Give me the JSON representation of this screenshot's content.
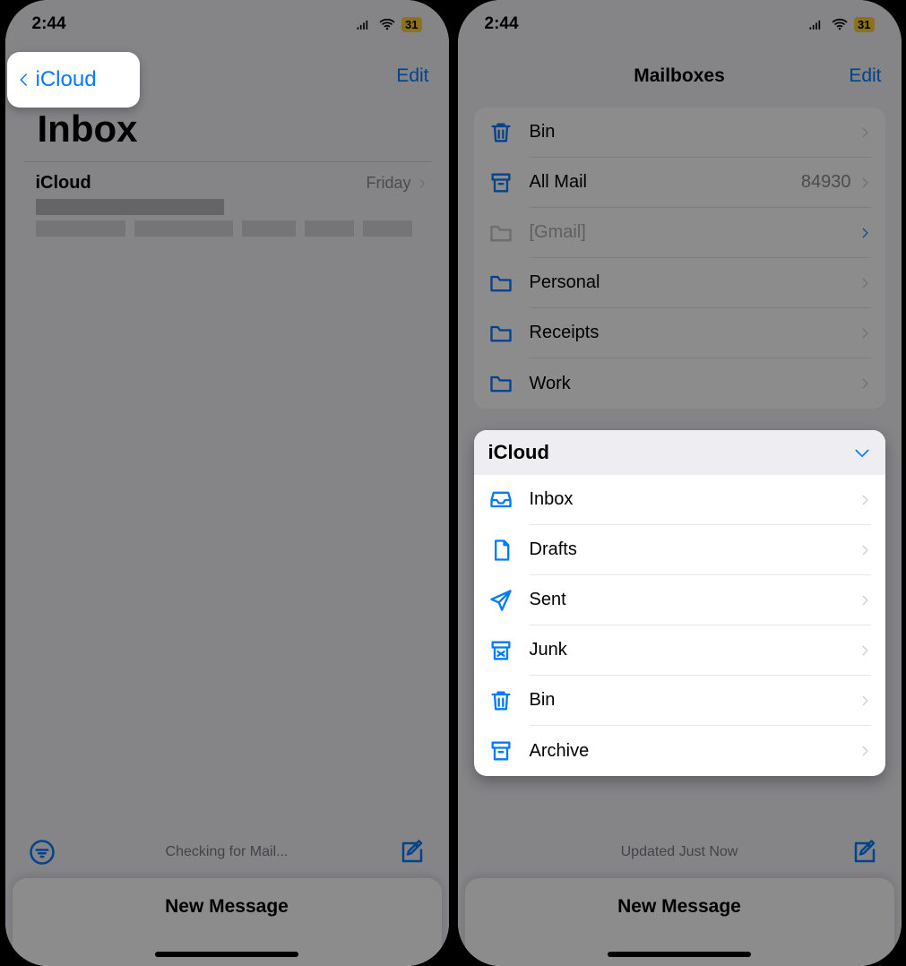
{
  "statusbar": {
    "time": "2:44",
    "battery": "31"
  },
  "left": {
    "nav": {
      "back": "iCloud",
      "edit": "Edit"
    },
    "title": "Inbox",
    "message": {
      "sender": "iCloud",
      "when": "Friday"
    },
    "toolbar_status": "Checking for Mail...",
    "sheet_title": "New Message"
  },
  "right": {
    "nav": {
      "title": "Mailboxes",
      "edit": "Edit"
    },
    "mailboxes": [
      {
        "icon": "trash",
        "label": "Bin",
        "count": ""
      },
      {
        "icon": "archive",
        "label": "All Mail",
        "count": "84930"
      },
      {
        "icon": "folder",
        "label": "[Gmail]",
        "count": "",
        "disabled": true
      },
      {
        "icon": "folder",
        "label": "Personal",
        "count": ""
      },
      {
        "icon": "folder",
        "label": "Receipts",
        "count": ""
      },
      {
        "icon": "folder",
        "label": "Work",
        "count": ""
      }
    ],
    "panel": {
      "title": "iCloud",
      "items": [
        {
          "icon": "inbox",
          "label": "Inbox"
        },
        {
          "icon": "doc",
          "label": "Drafts"
        },
        {
          "icon": "send",
          "label": "Sent"
        },
        {
          "icon": "junk",
          "label": "Junk"
        },
        {
          "icon": "trash",
          "label": "Bin"
        },
        {
          "icon": "archive",
          "label": "Archive"
        }
      ]
    },
    "toolbar_status": "Updated Just Now",
    "sheet_title": "New Message"
  }
}
